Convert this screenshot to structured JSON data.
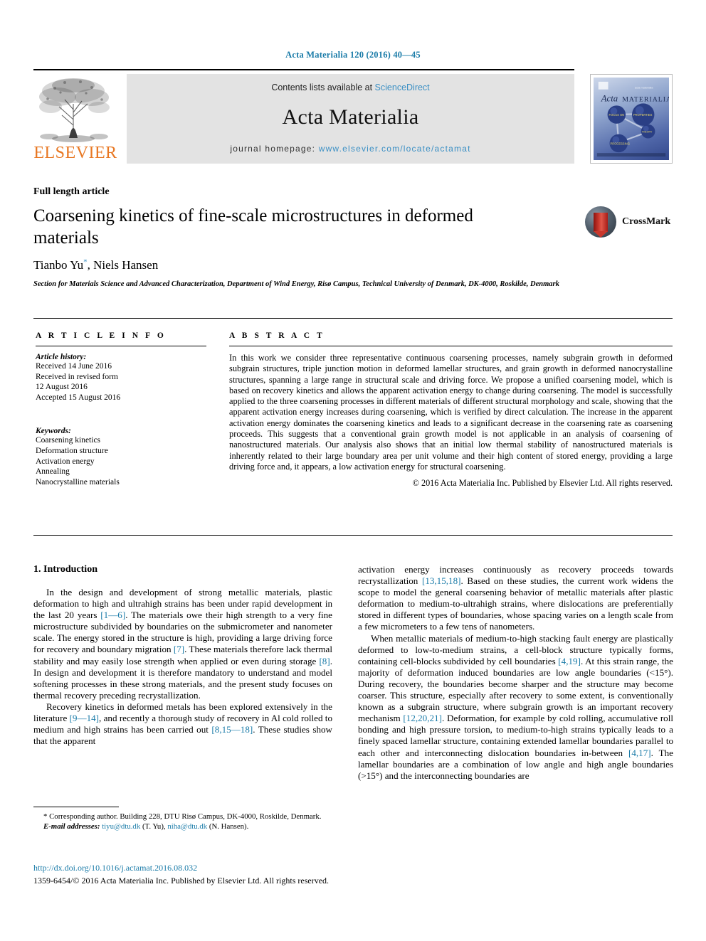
{
  "running_head": "Acta Materialia 120 (2016) 40—45",
  "masthead": {
    "contents_prefix": "Contents lists available at ",
    "sciencedirect": "ScienceDirect",
    "journal_title": "Acta Materialia",
    "homepage_label": "journal homepage: ",
    "homepage_url": "www.elsevier.com/locate/actamat",
    "publisher_wordmark": "ELSEVIER",
    "publisher_logo_icon": "elsevier-tree-icon",
    "cover_title_serif": "Acta",
    "cover_title_caps": "MATERIALIA",
    "cover_nodes": [
      "FOCUS ON",
      "PROPERTIES",
      "THEORY",
      "PROCESSING"
    ]
  },
  "article": {
    "type": "Full length article",
    "title": "Coarsening kinetics of fine-scale microstructures in deformed materials",
    "authors": "Tianbo Yu, Niels Hansen",
    "corresponding_marker": "*",
    "affiliation": "Section for Materials Science and Advanced Characterization, Department of Wind Energy, Risø Campus, Technical University of Denmark, DK-4000, Roskilde, Denmark",
    "crossmark_label": "CrossMark",
    "crossmark_icon": "crossmark-badge-icon"
  },
  "article_info": {
    "heading": "A R T I C L E   I N F O",
    "history_label": "Article history:",
    "history": [
      "Received 14 June 2016",
      "Received in revised form",
      "12 August 2016",
      "Accepted 15 August 2016"
    ],
    "keywords_label": "Keywords:",
    "keywords": [
      "Coarsening kinetics",
      "Deformation structure",
      "Activation energy",
      "Annealing",
      "Nanocrystalline materials"
    ]
  },
  "abstract": {
    "heading": "A B S T R A C T",
    "text": "In this work we consider three representative continuous coarsening processes, namely subgrain growth in deformed subgrain structures, triple junction motion in deformed lamellar structures, and grain growth in deformed nanocrystalline structures, spanning a large range in structural scale and driving force. We propose a unified coarsening model, which is based on recovery kinetics and allows the apparent activation energy to change during coarsening. The model is successfully applied to the three coarsening processes in different materials of different structural morphology and scale, showing that the apparent activation energy increases during coarsening, which is verified by direct calculation. The increase in the apparent activation energy dominates the coarsening kinetics and leads to a significant decrease in the coarsening rate as coarsening proceeds. This suggests that a conventional grain growth model is not applicable in an analysis of coarsening of nanostructured materials. Our analysis also shows that an initial low thermal stability of nanostructured materials is inherently related to their large boundary area per unit volume and their high content of stored energy, providing a large driving force and, it appears, a low activation energy for structural coarsening.",
    "copyright": "© 2016 Acta Materialia Inc. Published by Elsevier Ltd. All rights reserved."
  },
  "introduction": {
    "heading": "1. Introduction",
    "left_paragraphs": [
      "In the design and development of strong metallic materials, plastic deformation to high and ultrahigh strains has been under rapid development in the last 20 years [1—6]. The materials owe their high strength to a very fine microstructure subdivided by boundaries on the submicrometer and nanometer scale. The energy stored in the structure is high, providing a large driving force for recovery and boundary migration [7]. These materials therefore lack thermal stability and may easily lose strength when applied or even during storage [8]. In design and development it is therefore mandatory to understand and model softening processes in these strong materials, and the present study focuses on thermal recovery preceding recrystallization.",
      "Recovery kinetics in deformed metals has been explored extensively in the literature [9—14], and recently a thorough study of recovery in Al cold rolled to medium and high strains has been carried out [8,15—18]. These studies show that the apparent"
    ],
    "right_paragraphs": [
      "activation energy increases continuously as recovery proceeds towards recrystallization [13,15,18]. Based on these studies, the current work widens the scope to model the general coarsening behavior of metallic materials after plastic deformation to medium-to-ultrahigh strains, where dislocations are preferentially stored in different types of boundaries, whose spacing varies on a length scale from a few micrometers to a few tens of nanometers.",
      "When metallic materials of medium-to-high stacking fault energy are plastically deformed to low-to-medium strains, a cell-block structure typically forms, containing cell-blocks subdivided by cell boundaries [4,19]. At this strain range, the majority of deformation induced boundaries are low angle boundaries (<15°). During recovery, the boundaries become sharper and the structure may become coarser. This structure, especially after recovery to some extent, is conventionally known as a subgrain structure, where subgrain growth is an important recovery mechanism [12,20,21]. Deformation, for example by cold rolling, accumulative roll bonding and high pressure torsion, to medium-to-high strains typically leads to a finely spaced lamellar structure, containing extended lamellar boundaries parallel to each other and interconnecting dislocation boundaries in-between [4,17]. The lamellar boundaries are a combination of low angle and high angle boundaries (>15°) and the interconnecting boundaries are"
    ]
  },
  "footnote": {
    "corresponding": "* Corresponding author. Building 228, DTU Risø Campus, DK-4000, Roskilde, Denmark.",
    "email_label": "E-mail addresses:",
    "email_1": "tiyu@dtu.dk",
    "email_1_who": "(T. Yu),",
    "email_2": "niha@dtu.dk",
    "email_2_who": "(N. Hansen)."
  },
  "footer": {
    "doi": "http://dx.doi.org/10.1016/j.actamat.2016.08.032",
    "issn": "1359-6454/© 2016 Acta Materialia Inc. Published by Elsevier Ltd. All rights reserved."
  },
  "colors": {
    "link_blue": "#1a7ba8",
    "masthead_blue": "#3a8fc4",
    "elsevier_orange": "#e87722",
    "band_grey": "#e3e3e3"
  }
}
